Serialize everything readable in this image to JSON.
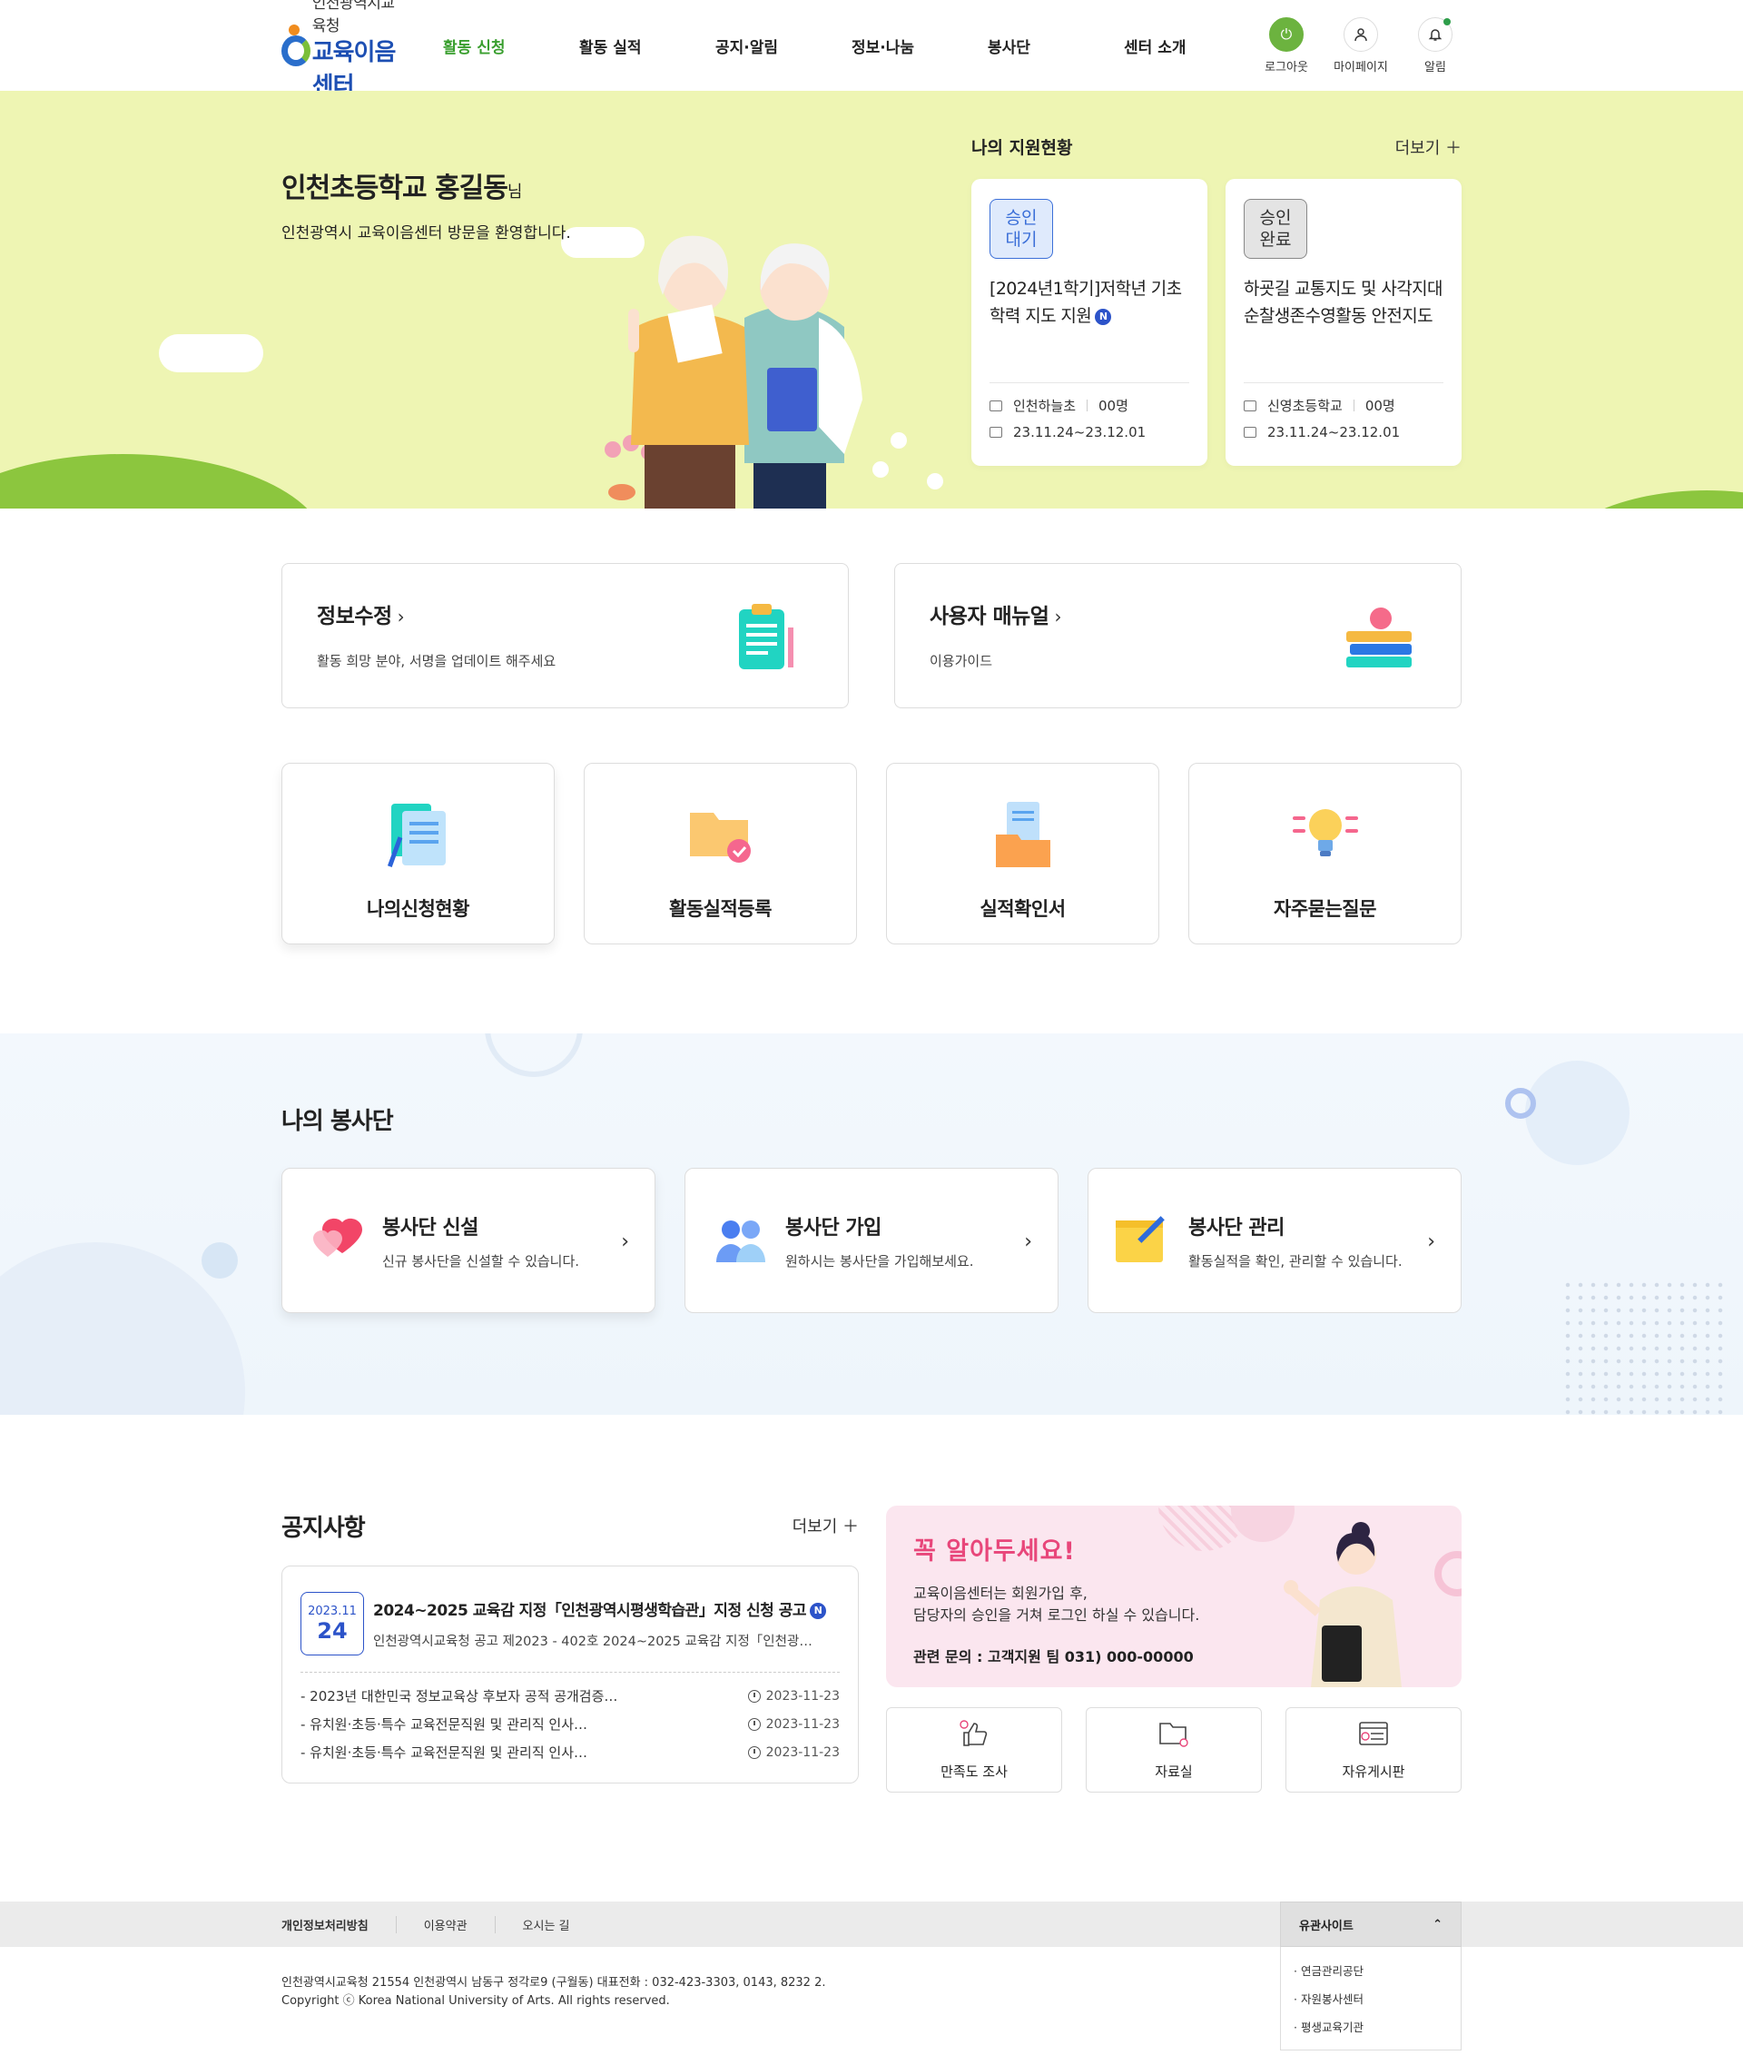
{
  "header": {
    "logo_sub": "인천광역시교육청",
    "logo_main": "교육이음센터",
    "nav": [
      "활동 신청",
      "활동 실적",
      "공지·알림",
      "정보·나눔",
      "봉사단",
      "센터 소개"
    ],
    "util": {
      "logout": "로그아웃",
      "mypage": "마이페이지",
      "alert": "알림"
    },
    "accent": "#3a9f2f"
  },
  "hero": {
    "user_name": "인천초등학교 홍길동",
    "user_suffix": "님",
    "welcome": "인천광역시 교육이음센터 방문을 환영합니다.",
    "status_title": "나의 지원현황",
    "more": "더보기",
    "cards": [
      {
        "badge": "승인\n대기",
        "badge_l1": "승인",
        "badge_l2": "대기",
        "title": "[2024년1학기]저학년 기초학력 지도 지원",
        "new": "N",
        "school": "인천하늘초",
        "count": "00명",
        "period": "23.11.24~23.12.01"
      },
      {
        "badge_l1": "승인",
        "badge_l2": "완료",
        "title": "하굣길 교통지도 및 사각지대 순찰생존수영활동 안전지도",
        "school": "신영초등학교",
        "count": "00명",
        "period": "23.11.24~23.12.01"
      }
    ]
  },
  "quick": {
    "info": {
      "title": "정보수정",
      "desc": "활동 희망 분야, 서명을 업데이트 해주세요",
      "icon": "clipboard-icon"
    },
    "manual": {
      "title": "사용자 매뉴얼",
      "desc": "이용가이드",
      "icon": "books-icon"
    },
    "menu": [
      {
        "label": "나의신청현황",
        "icon": "documents-icon"
      },
      {
        "label": "활동실적등록",
        "icon": "folder-check-icon"
      },
      {
        "label": "실적확인서",
        "icon": "certificate-icon"
      },
      {
        "label": "자주묻는질문",
        "icon": "lightbulb-icon"
      }
    ]
  },
  "volunteer": {
    "title": "나의 봉사단",
    "cards": [
      {
        "title": "봉사단 신설",
        "desc": "신규 봉사단을 신설할 수 있습니다.",
        "icon": "hearts-icon"
      },
      {
        "title": "봉사단 가입",
        "desc": "원하시는 봉사단을 가입해보세요.",
        "icon": "people-icon"
      },
      {
        "title": "봉사단 관리",
        "desc": "활동실적을 확인, 관리할 수 있습니다.",
        "icon": "note-pen-icon"
      }
    ]
  },
  "notice": {
    "title": "공지사항",
    "more": "더보기",
    "featured": {
      "ym": "2023.11",
      "day": "24",
      "title": "2024~2025 교육감 지정「인천광역시평생학습관」지정 신청 공고",
      "new": "N",
      "sub": "인천광역시교육청 공고 제2023 - 402호 2024~2025 교육감 지정「인천광…"
    },
    "items": [
      {
        "title": "- 2023년 대한민국 정보교육상 후보자 공적 공개검증…",
        "date": "2023-11-23"
      },
      {
        "title": "- 유치원·초등·특수 교육전문직원 및 관리직 인사…",
        "date": "2023-11-23"
      },
      {
        "title": "- 유치원·초등·특수 교육전문직원 및 관리직 인사…",
        "date": "2023-11-23"
      }
    ]
  },
  "info_box": {
    "title": "꼭 알아두세요!",
    "line1": "교육이음센터는 회원가입 후,",
    "line2": "담당자의 승인을 거쳐 로그인 하실 수 있습니다.",
    "contact": "관련 문의 : 고객지원 팀 031) 000-00000"
  },
  "shortcuts": [
    {
      "label": "만족도 조사",
      "icon": "thumbs-up-icon"
    },
    {
      "label": "자료실",
      "icon": "folder-icon"
    },
    {
      "label": "자유게시판",
      "icon": "board-icon"
    }
  ],
  "footer": {
    "links": [
      "개인정보처리방침",
      "이용약관",
      "오시는 길"
    ],
    "related_title": "유관사이트",
    "related": [
      "· 연금관리공단",
      "· 자원봉사센터",
      "· 평생교육기관"
    ],
    "address": "인천광역시교육청 21554 인천광역시 남동구 정각로9 (구월동) 대표전화 : 032-423-3303, 0143, 8232 2.",
    "copyright": "Copyright ⓒ Korea National University of Arts. All rights reserved."
  }
}
